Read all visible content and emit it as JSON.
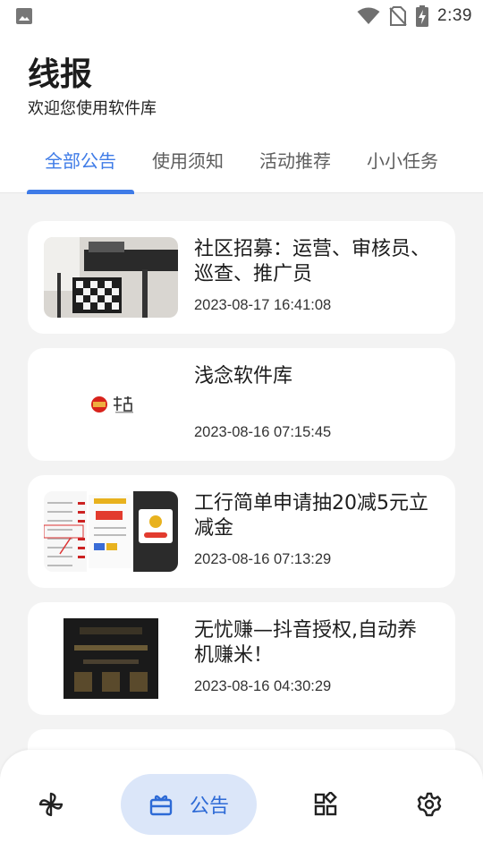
{
  "status_bar": {
    "time": "2:39",
    "left_icon": "image-icon",
    "right_icons": [
      "wifi-icon",
      "no-sim-icon",
      "battery-charging-icon"
    ]
  },
  "header": {
    "title": "线报",
    "subtitle": "欢迎您使用软件库"
  },
  "tabs": [
    {
      "label": "全部公告",
      "active": true
    },
    {
      "label": "使用须知",
      "active": false
    },
    {
      "label": "活动推荐",
      "active": false
    },
    {
      "label": "小小任务",
      "active": false
    }
  ],
  "posts": [
    {
      "title": "社区招募：运营、审核员、巡查、推广员",
      "date": "2023-08-17 16:41:08"
    },
    {
      "title": "浅念软件库",
      "date": "2023-08-16 07:15:45"
    },
    {
      "title": "工行简单申请抽20减5元立减金",
      "date": "2023-08-16 07:13:29"
    },
    {
      "title": "无忧赚—抖音授权,自动养机赚米！",
      "date": "2023-08-16 04:30:29"
    }
  ],
  "bottom_nav": {
    "items": [
      {
        "icon": "pinwheel-icon",
        "label": ""
      },
      {
        "icon": "gift-icon",
        "label": "公告",
        "active": true
      },
      {
        "icon": "apps-grid-icon",
        "label": ""
      },
      {
        "icon": "settings-gear-icon",
        "label": ""
      }
    ]
  },
  "colors": {
    "accent": "#3e7be7",
    "nav_pill": "#dbe6f9",
    "background": "#f3f3f3"
  }
}
